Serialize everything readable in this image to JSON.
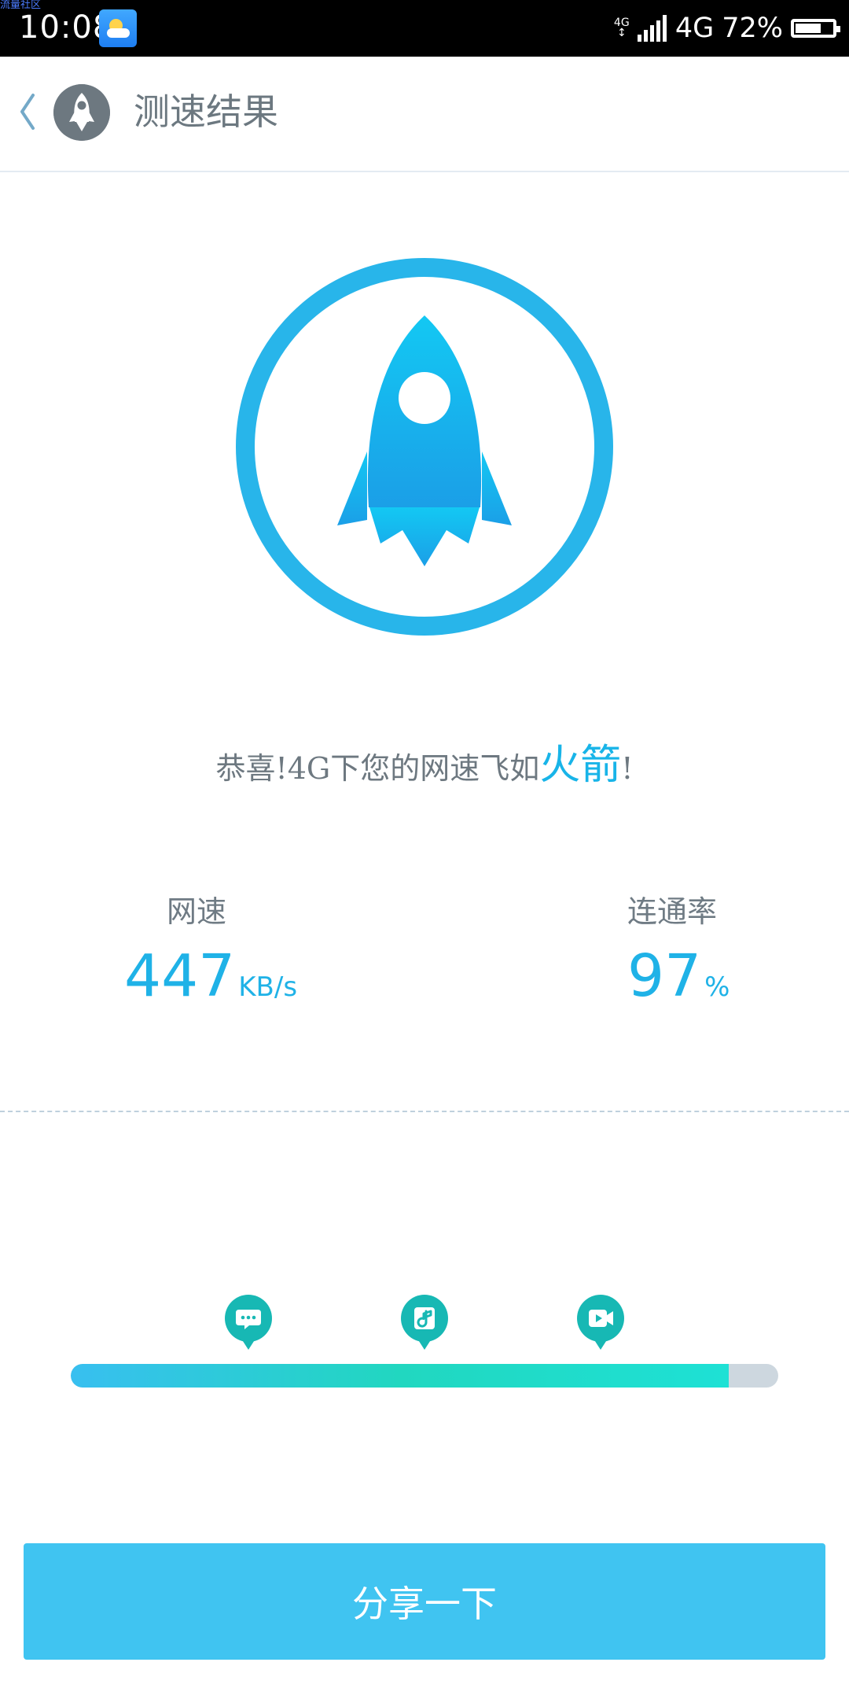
{
  "status_bar": {
    "watermark": "流量社区",
    "time": "10:08",
    "network_small_top": "4G",
    "network_small_bottom": "↕",
    "network": "4G",
    "battery": "72%",
    "battery_level": 0.72
  },
  "header": {
    "title": "测速结果"
  },
  "result": {
    "message_prefix": "恭喜!4G下您的网速飞如",
    "message_highlight": "火箭",
    "message_suffix": "!"
  },
  "stats": {
    "speed": {
      "label": "网速",
      "value": "447",
      "unit": "KB/s"
    },
    "connectivity": {
      "label": "连通率",
      "value": "97",
      "unit": "%"
    }
  },
  "progress": {
    "level": 0.93,
    "markers": [
      "chat-icon",
      "music-icon",
      "video-icon"
    ]
  },
  "actions": {
    "share_label": "分享一下"
  },
  "colors": {
    "primary": "#1fb2e7",
    "button": "#40c4f1",
    "marker": "#17b8b4",
    "progress_start": "#38bff0",
    "progress_end": "#1ee1d5"
  }
}
